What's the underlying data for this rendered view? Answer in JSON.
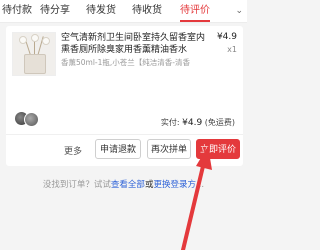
{
  "tabs": [
    {
      "label": "待付款"
    },
    {
      "label": "待分享"
    },
    {
      "label": "待发货"
    },
    {
      "label": "待收货"
    },
    {
      "label": "待评价"
    }
  ],
  "order": {
    "title": "空气清新剂卫生间卧室持久留香室内熏香厕所除臭家用香薰精油香水",
    "price": "¥4.9",
    "quantity": "x1",
    "spec": "香薰50ml-1瓶,小苍兰【纯洁清香-清香",
    "paid_label": "实付:",
    "paid_amount": "¥4.9",
    "paid_note": "(免运费)",
    "more": "更多",
    "refund": "申请退款",
    "again": "再次拼单",
    "review": "立即评价"
  },
  "footer": {
    "prefix": "没找到订单？试试",
    "link1": "查看全部",
    "mid": "或",
    "link2": "更换登录方",
    "suffix": "..."
  },
  "colors": {
    "accent": "#e4393c",
    "link": "#2f63d8"
  }
}
